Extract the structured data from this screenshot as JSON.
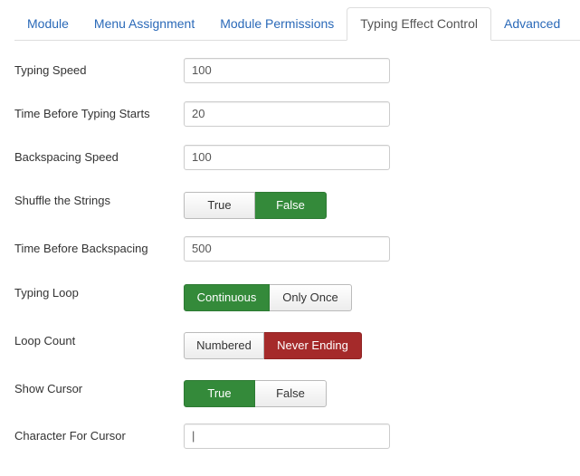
{
  "tabs": [
    {
      "label": "Module"
    },
    {
      "label": "Menu Assignment"
    },
    {
      "label": "Module Permissions"
    },
    {
      "label": "Typing Effect Control"
    },
    {
      "label": "Advanced"
    }
  ],
  "form": {
    "typing_speed": {
      "label": "Typing Speed",
      "value": "100"
    },
    "time_before_typing": {
      "label": "Time Before Typing Starts",
      "value": "20"
    },
    "backspacing_speed": {
      "label": "Backspacing Speed",
      "value": "100"
    },
    "shuffle": {
      "label": "Shuffle the Strings",
      "options": [
        "True",
        "False"
      ],
      "selected": "False"
    },
    "time_before_backspacing": {
      "label": "Time Before Backspacing",
      "value": "500"
    },
    "typing_loop": {
      "label": "Typing Loop",
      "options": [
        "Continuous",
        "Only Once"
      ],
      "selected": "Continuous"
    },
    "loop_count": {
      "label": "Loop Count",
      "options": [
        "Numbered",
        "Never Ending"
      ],
      "selected": "Never Ending"
    },
    "show_cursor": {
      "label": "Show Cursor",
      "options": [
        "True",
        "False"
      ],
      "selected": "True"
    },
    "cursor_char": {
      "label": "Character For Cursor",
      "value": "|"
    }
  },
  "colors": {
    "tab_link": "#2a69b8",
    "active_green": "#348a3a",
    "active_red": "#a52a2a"
  }
}
